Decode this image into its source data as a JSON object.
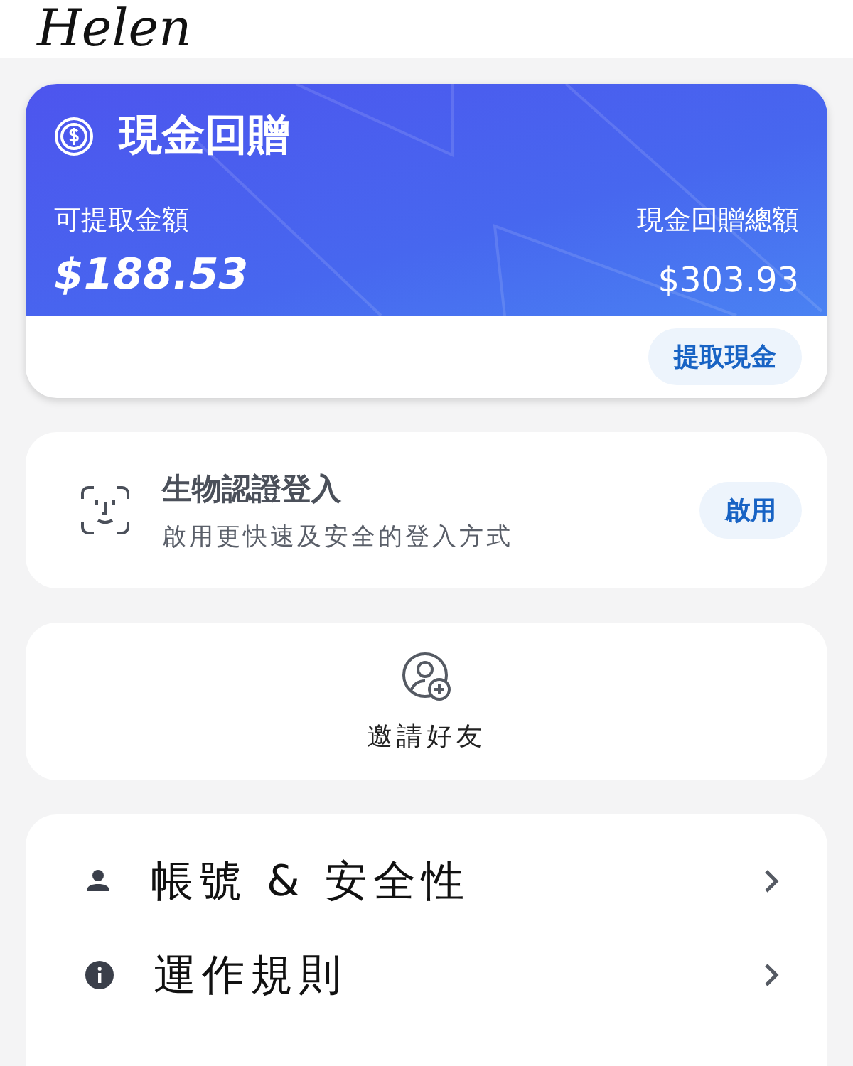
{
  "header": {
    "name": "Helen"
  },
  "cashback": {
    "title": "現金回贈",
    "withdrawable_label": "可提取金額",
    "withdrawable_amount": "$188.53",
    "total_label": "現金回贈總額",
    "total_amount": "$303.93",
    "button": "提取現金"
  },
  "biometric": {
    "title": "生物認證登入",
    "subtitle": "啟用更快速及安全的登入方式",
    "button": "啟用"
  },
  "invite": {
    "label": "邀請好友"
  },
  "menu": [
    {
      "label": "帳號 & 安全性",
      "kind": "person"
    },
    {
      "label": "運作規則",
      "kind": "info"
    }
  ]
}
